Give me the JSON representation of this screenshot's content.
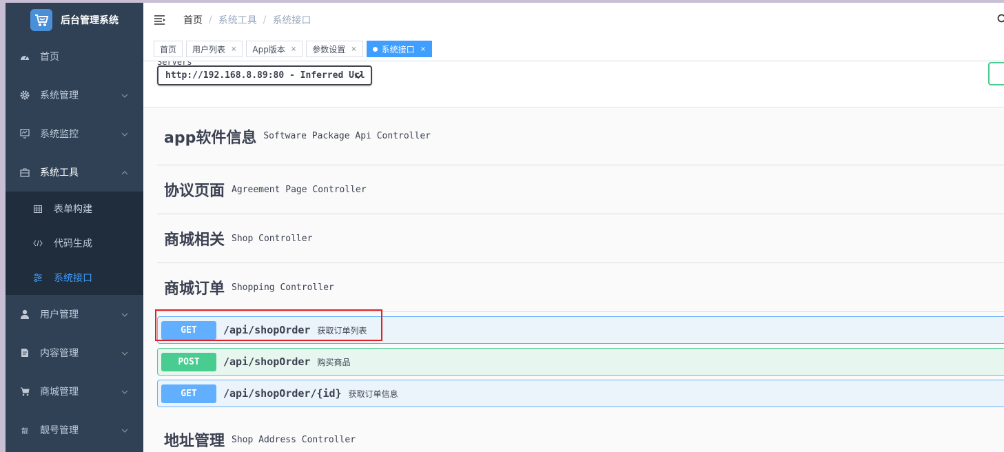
{
  "sidebar": {
    "title": "后台管理系统",
    "items": [
      {
        "label": "首页",
        "icon": "dashboard-icon"
      },
      {
        "label": "系统管理",
        "icon": "gear-icon"
      },
      {
        "label": "系统监控",
        "icon": "monitor-icon"
      },
      {
        "label": "系统工具",
        "icon": "toolbox-icon"
      },
      {
        "label": "用户管理",
        "icon": "user-icon"
      },
      {
        "label": "内容管理",
        "icon": "document-icon"
      },
      {
        "label": "商城管理",
        "icon": "cart-icon"
      },
      {
        "label": "靓号管理",
        "icon": "phone-number-icon",
        "icon_text": "靓"
      }
    ],
    "subitems": [
      {
        "label": "表单构建",
        "icon": "grid-icon"
      },
      {
        "label": "代码生成",
        "icon": "code-icon"
      },
      {
        "label": "系统接口",
        "icon": "sliders-icon",
        "active": true
      }
    ]
  },
  "breadcrumb": [
    "首页",
    "系统工具",
    "系统接口"
  ],
  "tags": [
    {
      "label": "首页",
      "closable": false,
      "active": false
    },
    {
      "label": "用户列表",
      "closable": true,
      "active": false
    },
    {
      "label": "App版本",
      "closable": true,
      "active": false
    },
    {
      "label": "参数设置",
      "closable": true,
      "active": false
    },
    {
      "label": "系统接口",
      "closable": true,
      "active": true
    }
  ],
  "tag_close_glyph": "×",
  "servers": {
    "label": "Servers",
    "selected": "http://192.168.8.89:80 - Inferred Url"
  },
  "sections": [
    {
      "title": "app软件信息",
      "desc": "Software Package Api Controller"
    },
    {
      "title": "协议页面",
      "desc": "Agreement Page Controller"
    },
    {
      "title": "商城相关",
      "desc": "Shop Controller"
    },
    {
      "title": "商城订单",
      "desc": "Shopping Controller"
    }
  ],
  "operations": [
    {
      "method": "GET",
      "path": "/api/shopOrder",
      "summary": "获取订单列表"
    },
    {
      "method": "POST",
      "path": "/api/shopOrder",
      "summary": "购买商品"
    },
    {
      "method": "GET",
      "path": "/api/shopOrder/{id}",
      "summary": "获取订单信息"
    }
  ],
  "next_section": {
    "title": "地址管理",
    "desc": "Shop Address Controller"
  },
  "colors": {
    "sidebar_bg": "#304156",
    "submenu_bg": "#1f2d3d",
    "accent": "#409eff",
    "get": "#61affe",
    "post": "#49cc90",
    "highlight": "#e02020"
  }
}
